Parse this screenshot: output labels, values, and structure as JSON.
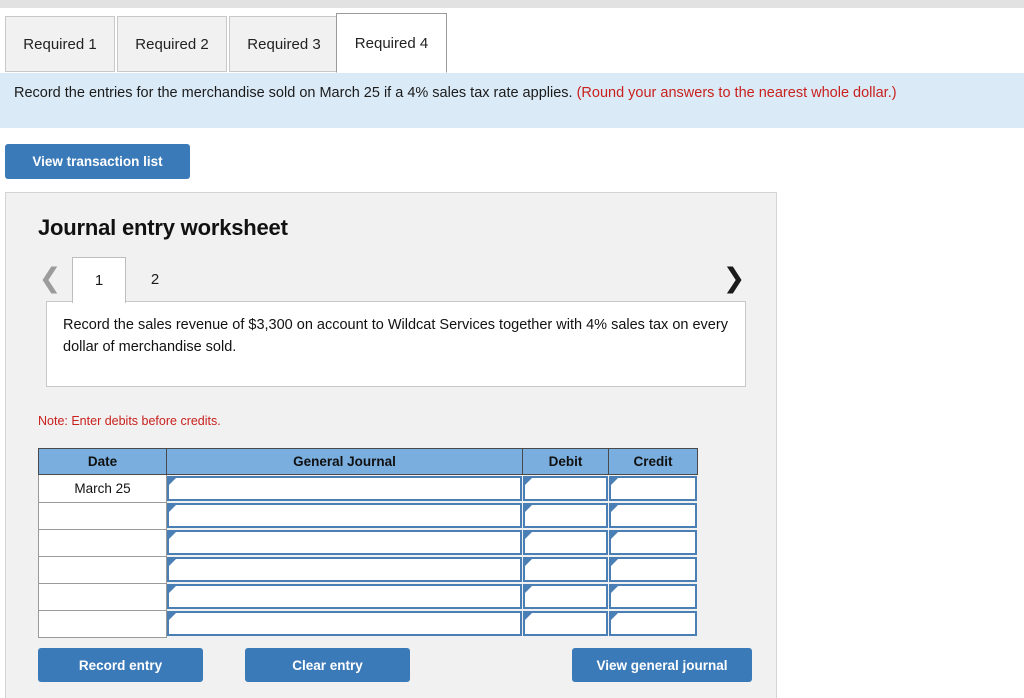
{
  "tabs": [
    {
      "label": "Required 1",
      "active": false
    },
    {
      "label": "Required 2",
      "active": false
    },
    {
      "label": "Required 3",
      "active": false
    },
    {
      "label": "Required 4",
      "active": true
    }
  ],
  "banner": {
    "text": "Record the entries for the merchandise sold on March 25 if a 4% sales tax rate applies. ",
    "rounding_note": "(Round your answers to the nearest whole dollar.)"
  },
  "toolbar": {
    "view_transaction_list": "View transaction list"
  },
  "worksheet": {
    "title": "Journal entry worksheet",
    "pager": {
      "prev_icon": "chevron-left-icon",
      "next_icon": "chevron-right-icon",
      "pages": [
        {
          "label": "1",
          "active": true
        },
        {
          "label": "2",
          "active": false
        }
      ]
    },
    "description": "Record the sales revenue of $3,300 on account to Wildcat Services together with 4% sales tax on every dollar of merchandise sold.",
    "note": "Note: Enter debits before credits.",
    "table": {
      "headers": [
        "Date",
        "General Journal",
        "Debit",
        "Credit"
      ],
      "rows": [
        {
          "date": "March 25",
          "general_journal": "",
          "debit": "",
          "credit": ""
        },
        {
          "date": "",
          "general_journal": "",
          "debit": "",
          "credit": ""
        },
        {
          "date": "",
          "general_journal": "",
          "debit": "",
          "credit": ""
        },
        {
          "date": "",
          "general_journal": "",
          "debit": "",
          "credit": ""
        },
        {
          "date": "",
          "general_journal": "",
          "debit": "",
          "credit": ""
        },
        {
          "date": "",
          "general_journal": "",
          "debit": "",
          "credit": ""
        }
      ]
    },
    "buttons": {
      "record_entry": "Record entry",
      "clear_entry": "Clear entry",
      "view_general_journal": "View general journal"
    }
  },
  "colors": {
    "accent_blue": "#3b7ab8",
    "banner_blue": "#dbeaf7",
    "table_header_blue": "#7aaede",
    "input_border_blue": "#4a7fb5",
    "alert_red": "#c9211e",
    "panel_gray": "#f1f1f1"
  }
}
